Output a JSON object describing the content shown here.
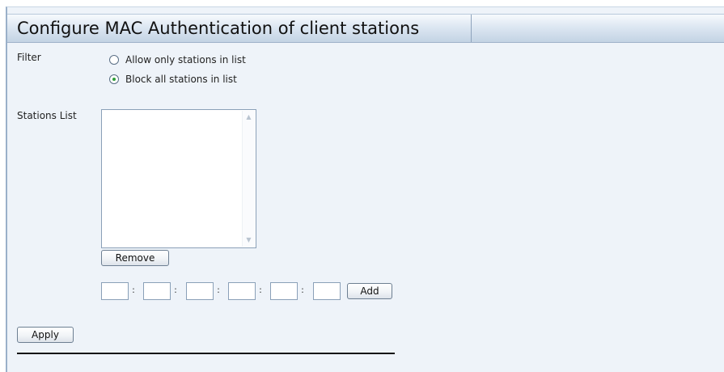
{
  "header": {
    "title": "Configure MAC Authentication of client stations"
  },
  "filter": {
    "label": "Filter",
    "options": [
      {
        "label": "Allow only stations in list",
        "selected": false
      },
      {
        "label": "Block all stations in list",
        "selected": true
      }
    ]
  },
  "stations": {
    "label": "Stations List",
    "items": [],
    "remove_label": "Remove"
  },
  "mac_entry": {
    "octets": [
      "",
      "",
      "",
      "",
      "",
      ""
    ],
    "separator": ":",
    "add_label": "Add"
  },
  "apply_label": "Apply"
}
